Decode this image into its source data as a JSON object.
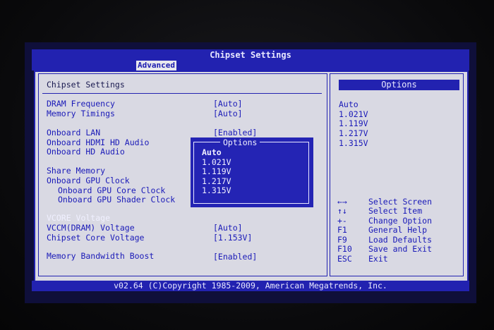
{
  "header": {
    "title": "Chipset Settings",
    "active_tab": "Advanced"
  },
  "section": {
    "title": "Chipset Settings"
  },
  "settings": [
    {
      "label": "DRAM Frequency",
      "value": "[Auto]"
    },
    {
      "label": "Memory Timings",
      "value": "[Auto]"
    },
    {
      "label": "Onboard LAN",
      "value": "[Enabled]"
    },
    {
      "label": "Onboard HDMI HD Audio",
      "value": ""
    },
    {
      "label": "Onboard HD Audio",
      "value": ""
    },
    {
      "label": "Share Memory",
      "value": ""
    },
    {
      "label": "Onboard GPU Clock",
      "value": ""
    },
    {
      "label": "Onboard GPU Core Clock",
      "value": ""
    },
    {
      "label": "Onboard GPU Shader Clock",
      "value": ""
    },
    {
      "label": "VCORE Voltage",
      "value": ""
    },
    {
      "label": "VCCM(DRAM) Voltage",
      "value": "[Auto]"
    },
    {
      "label": "Chipset Core Voltage",
      "value": "[1.153V]"
    },
    {
      "label": "Memory Bandwidth Boost",
      "value": "[Enabled]"
    }
  ],
  "options_panel": {
    "title": "Options",
    "items": [
      "Auto",
      "1.021V",
      "1.119V",
      "1.217V",
      "1.315V"
    ]
  },
  "popup": {
    "title": "Options",
    "items": [
      "Auto",
      "1.021V",
      "1.119V",
      "1.217V",
      "1.315V"
    ],
    "selected": "Auto"
  },
  "help": [
    {
      "key": "←→",
      "desc": "Select Screen"
    },
    {
      "key": "↑↓",
      "desc": "Select Item"
    },
    {
      "key": "+-",
      "desc": "Change Option"
    },
    {
      "key": "F1",
      "desc": "General Help"
    },
    {
      "key": "F9",
      "desc": "Load Defaults"
    },
    {
      "key": "F10",
      "desc": "Save and Exit"
    },
    {
      "key": "ESC",
      "desc": "Exit"
    }
  ],
  "footer": {
    "text": "v02.64 (C)Copyright 1985-2009, American Megatrends, Inc."
  },
  "colors": {
    "bios_blue": "#2222b0",
    "panel_gray": "#d9d9e3",
    "text_blue": "#1a1ab8"
  }
}
